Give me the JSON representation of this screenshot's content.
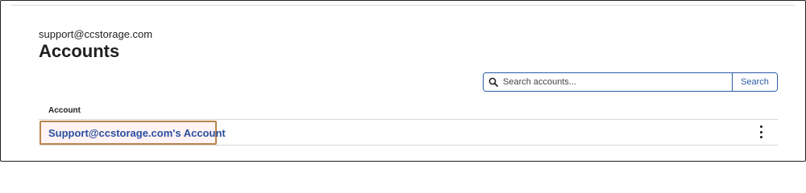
{
  "header": {
    "user_email": "support@ccstorage.com",
    "page_title": "Accounts"
  },
  "search": {
    "placeholder": "Search accounts...",
    "value": "",
    "button_label": "Search",
    "icon": "search-icon"
  },
  "table": {
    "columns": [
      "Account"
    ],
    "rows": [
      {
        "account_name": "Support@ccstorage.com's Account",
        "menu_icon": "more-vertical-icon"
      }
    ]
  },
  "colors": {
    "link": "#2a4f9e",
    "accent": "#2d5aa6",
    "highlight_border": "#b8864b"
  }
}
